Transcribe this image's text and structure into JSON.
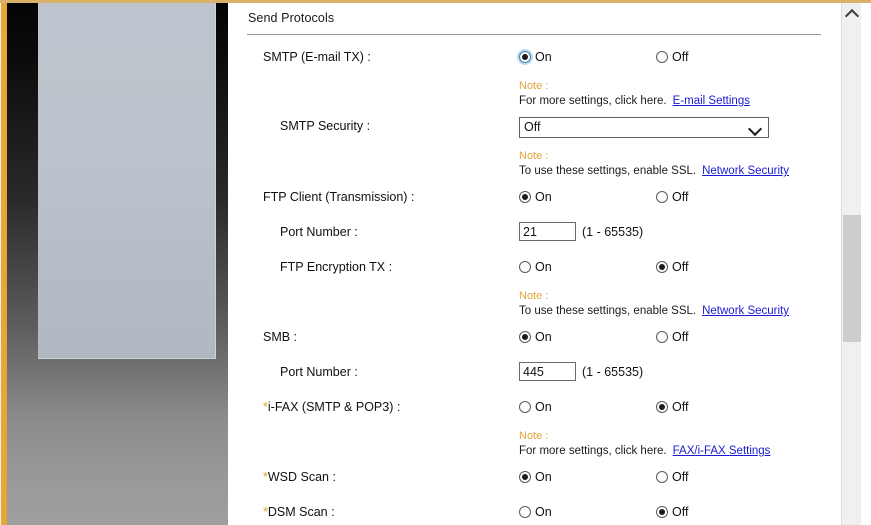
{
  "window": {
    "section_title": "Send Protocols"
  },
  "notes": {
    "head": "Note :",
    "more_settings": "For more settings, click here.",
    "enable_ssl": "To use these settings, enable SSL."
  },
  "links": {
    "email_settings": "E-mail Settings",
    "network_security": "Network Security",
    "fax_ifax_settings": "FAX/i-FAX Settings"
  },
  "options": {
    "on": "On",
    "off": "Off"
  },
  "rows": {
    "smtp": {
      "label": "SMTP (E-mail TX) :",
      "value": "On"
    },
    "smtp_security": {
      "label": "SMTP Security :",
      "value": "Off"
    },
    "ftp_client": {
      "label": "FTP Client (Transmission) :",
      "value": "On"
    },
    "ftp_port": {
      "label": "Port Number :",
      "value": "21",
      "range": "(1 - 65535)"
    },
    "ftp_encryption": {
      "label": "FTP Encryption TX :",
      "value": "Off"
    },
    "smb": {
      "label": "SMB :",
      "value": "On"
    },
    "smb_port": {
      "label": "Port Number :",
      "value": "445",
      "range": "(1 - 65535)"
    },
    "ifax": {
      "label": "i-FAX (SMTP & POP3) :",
      "star": "*",
      "value": "Off"
    },
    "wsd_scan": {
      "label": "WSD Scan :",
      "star": "*",
      "value": "On"
    },
    "dsm_scan": {
      "label": "DSM Scan :",
      "star": "*",
      "value": "Off"
    }
  },
  "colors": {
    "note_orange": "#e3a33a",
    "link_blue": "#1a1ad0",
    "frame_gold": "#e5ab3b",
    "required_star": "#e0a22a"
  }
}
